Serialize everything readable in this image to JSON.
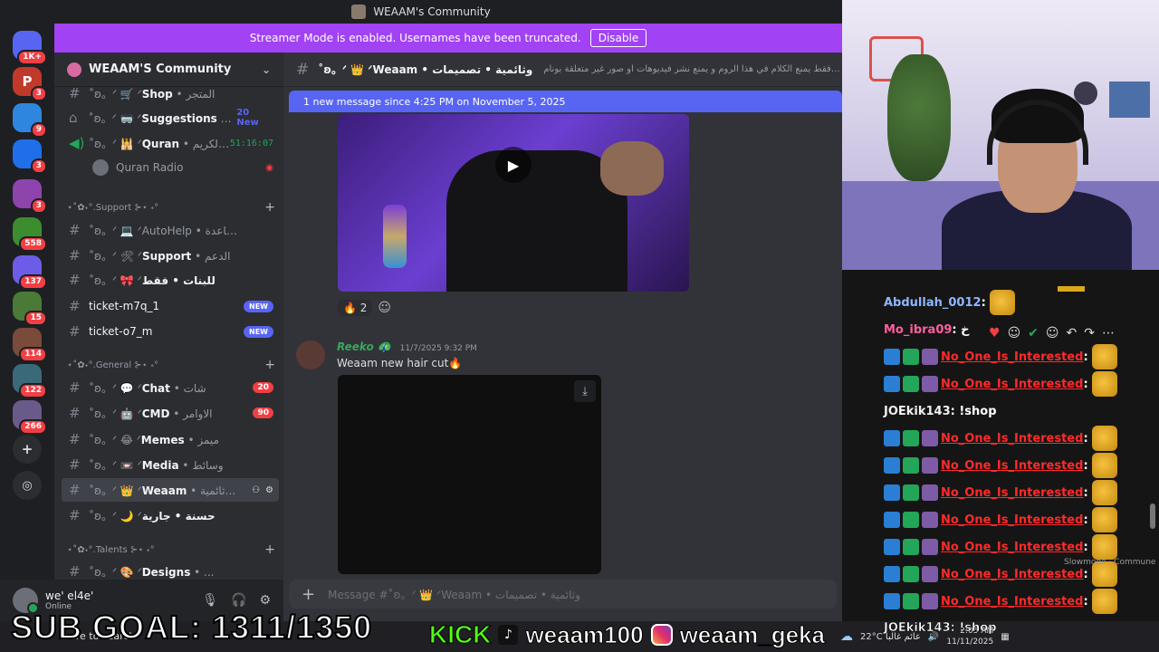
{
  "window": {
    "title": "WEAAM's Community"
  },
  "banner": {
    "text": "Streamer Mode is enabled. Usernames have been truncated.",
    "button": "Disable"
  },
  "rail": {
    "servers": [
      {
        "label": "",
        "badge": "1K+",
        "color": "#5865f2"
      },
      {
        "label": "P",
        "badge": "3",
        "color": "#c0392b"
      },
      {
        "label": "",
        "badge": "9",
        "color": "#2e86de"
      },
      {
        "label": "",
        "badge": "3",
        "color": "#1f6feb"
      },
      {
        "label": "",
        "badge": "3",
        "color": "#8e44ad"
      },
      {
        "label": "",
        "badge": "558",
        "color": "#3c8d2f"
      },
      {
        "label": "",
        "badge": "137",
        "color": "#6c5ce7"
      },
      {
        "label": "",
        "badge": "15",
        "color": "#4a7a36"
      },
      {
        "label": "",
        "badge": "114",
        "color": "#7a4a3a"
      },
      {
        "label": "",
        "badge": "122",
        "color": "#3a6a7a"
      },
      {
        "label": "",
        "badge": "266",
        "color": "#6a5a8a"
      }
    ],
    "add_icon": "plus-icon",
    "explore_icon": "compass-icon"
  },
  "guild": {
    "name": "WEAAM'S Community"
  },
  "channels": {
    "shop": {
      "prefix": "˚ʚ。ᐟ 🛒 ᐟ",
      "name": "Shop",
      "suffix": " • المتجر"
    },
    "suggestions": {
      "prefix": "˚ʚ。ᐟ 🥽 ᐟ",
      "name": "Suggestions",
      "suffix": " • ...",
      "side": "20 New"
    },
    "quran": {
      "prefix": "˚ʚ。ᐟ 🕌 ᐟ",
      "name": "Quran",
      "suffix": " • القرآن الكريم",
      "timer": "51:16:07"
    },
    "quran_radio": {
      "name": "Quran Radio"
    },
    "cat_support": {
      "label": "⋆˚✿˖°.Support ⊱⋆ ˖°"
    },
    "autohelp": {
      "prefix": "˚ʚ。ᐟ 💻 ᐟ",
      "name": "AutoHelp",
      "suffix": " • مساعدة"
    },
    "support": {
      "prefix": "˚ʚ。ᐟ 🛠 ᐟ",
      "name": "Support",
      "suffix": " • الدعم"
    },
    "girls": {
      "prefix": "˚ʚ。ᐟ 🎀 ᐟ",
      "name": "",
      "suffix": "للبنات • فقط"
    },
    "ticket1": {
      "name": "ticket-m7q_1",
      "badge": "NEW"
    },
    "ticket2": {
      "name": "ticket-o7_m",
      "badge": "NEW"
    },
    "cat_general": {
      "label": "⋆˚✿˖°.General ⊱⋆ ˖°"
    },
    "chat": {
      "prefix": "˚ʚ。ᐟ 💬 ᐟ",
      "name": "Chat",
      "suffix": " • شات",
      "badge": "20"
    },
    "cmd": {
      "prefix": "˚ʚ。ᐟ 🤖 ᐟ",
      "name": "CMD",
      "suffix": " • الاوامر",
      "badge": "90"
    },
    "memes": {
      "prefix": "˚ʚ。ᐟ 😂 ᐟ",
      "name": "Memes",
      "suffix": " • ميمز"
    },
    "media": {
      "prefix": "˚ʚ。ᐟ 📼 ᐟ",
      "name": "Media",
      "suffix": " • وسائط"
    },
    "weaam": {
      "prefix": "˚ʚ。ᐟ 👑 ᐟ",
      "name": "Weaam",
      "suffix": " • وثائمية..."
    },
    "hasana": {
      "prefix": "˚ʚ。ᐟ 🌙 ᐟ",
      "name": "",
      "suffix": "حسنة • جارية"
    },
    "cat_talents": {
      "label": "⋆˚✿˖°.Talents ⊱⋆ ˖°"
    },
    "designs": {
      "prefix": "˚ʚ。ᐟ 🎨 ᐟ",
      "name": "Designs",
      "suffix": " • ..."
    }
  },
  "user": {
    "name": "we' el4e'",
    "status": "Online"
  },
  "header": {
    "channel": "˚ʚ。ᐟ 👑 ᐟWeaam • وثائمية • تصميمات",
    "topic": "م فيديوهات وصور فقط يمنع الكلام في هذا الروم و يمنع نشر فيديوهات او صور غير متعلقة بونام"
  },
  "chat": {
    "new_messages": "1 new message since 4:25 PM on November 5, 2025",
    "reaction_emoji": "🔥",
    "reaction_count": "2",
    "message": {
      "author": "Reeko 🦚",
      "timestamp": "11/7/2025 9:32 PM",
      "text": "Weaam new hair cut🔥"
    }
  },
  "composer": {
    "placeholder": "Message #˚ʚ。ᐟ 👑 ᐟWeaam • وثائمية • تصميمات"
  },
  "stream_chat": {
    "lines": [
      {
        "user": "Abdullah_0012",
        "text": ":",
        "style": "nm-blue",
        "emote": true,
        "badges": 0
      },
      {
        "user": "Mo_ibra09",
        "text": ": خ",
        "style": "nm-pink",
        "emote": false,
        "badges": 0
      },
      {
        "user": "No_One_Is_Interested",
        "text": ":",
        "style": "nm-red",
        "emote": true,
        "badges": 3
      },
      {
        "user": "No_One_Is_Interested",
        "text": ":",
        "style": "nm-red",
        "emote": true,
        "badges": 3
      },
      {
        "user": "JOEkik143",
        "text": ": !shop",
        "style": "nm-white",
        "emote": false,
        "badges": 0
      },
      {
        "user": "No_One_Is_Interested",
        "text": ":",
        "style": "nm-red",
        "emote": true,
        "badges": 3
      },
      {
        "user": "No_One_Is_Interested",
        "text": ":",
        "style": "nm-red",
        "emote": true,
        "badges": 3
      },
      {
        "user": "No_One_Is_Interested",
        "text": ":",
        "style": "nm-red",
        "emote": true,
        "badges": 3
      },
      {
        "user": "No_One_Is_Interested",
        "text": ":",
        "style": "nm-red",
        "emote": true,
        "badges": 3
      },
      {
        "user": "No_One_Is_Interested",
        "text": ":",
        "style": "nm-red",
        "emote": true,
        "badges": 3
      },
      {
        "user": "No_One_Is_Interested",
        "text": ":",
        "style": "nm-red",
        "emote": true,
        "badges": 3
      },
      {
        "user": "No_One_Is_Interested",
        "text": ":",
        "style": "nm-red",
        "emote": true,
        "badges": 3
      }
    ],
    "slow_mode": "Slowmode · Commune",
    "bottom_line": "JOEkik143: !shop"
  },
  "overlay": {
    "sub_goal": "SUB GOAL: 1311/1350",
    "kick_logo": "KICK",
    "kick_handle": "weaam100",
    "ig_handle": "weaam_geka"
  },
  "taskbar": {
    "search": "here to search",
    "weather": "22°C عائم غالبا",
    "time": "2:05 AM",
    "date": "11/11/2025"
  }
}
